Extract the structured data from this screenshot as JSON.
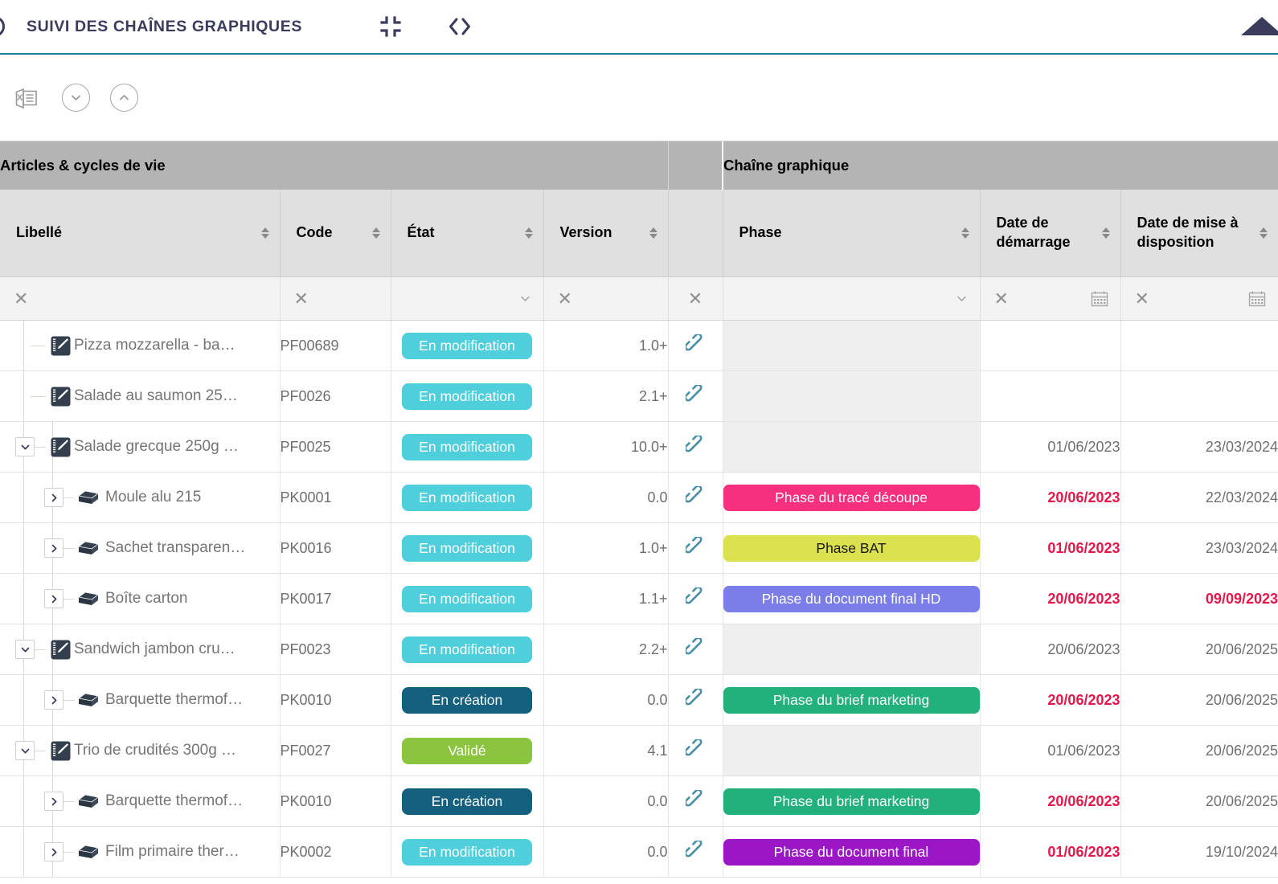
{
  "header": {
    "title": "SUIVI DES CHAÎNES GRAPHIQUES",
    "logo_icon": "circle-logo-icon",
    "collapse_icon": "collapse-fullscreen-icon",
    "code_icon": "code-brackets-icon",
    "panel_toggle_icon": "triangle-up-icon"
  },
  "toolbar": {
    "export_excel": {
      "icon": "excel-export-icon",
      "label": ""
    },
    "expand_all": {
      "icon": "chevron-down-circle-icon",
      "label": ""
    },
    "collapse_all": {
      "icon": "chevron-up-circle-icon",
      "label": ""
    }
  },
  "groups": [
    {
      "label": "Articles & cycles de vie"
    },
    {
      "label": "Chaîne graphique"
    }
  ],
  "columns": [
    {
      "key": "libelle",
      "label": "Libellé",
      "sortable": true,
      "filter": "clear"
    },
    {
      "key": "code",
      "label": "Code",
      "sortable": true,
      "filter": "clear"
    },
    {
      "key": "etat",
      "label": "État",
      "sortable": true,
      "filter": "dropdown"
    },
    {
      "key": "version",
      "label": "Version",
      "sortable": true,
      "filter": "clear"
    },
    {
      "key": "lien",
      "label": "",
      "sortable": false,
      "filter": "clear"
    },
    {
      "key": "phase",
      "label": "Phase",
      "sortable": true,
      "filter": "dropdown"
    },
    {
      "key": "date_demarrage",
      "label": "Date de démarrage",
      "sortable": true,
      "filter": "clear-calendar"
    },
    {
      "key": "date_mise_a_disposition",
      "label": "Date de mise à disposition",
      "sortable": true,
      "filter": "clear-calendar"
    }
  ],
  "colors": {
    "accent_underline": "#1b7f94",
    "brand_dark": "#3b3b5c",
    "group_band": "#b4b4b4",
    "column_header": "#e0e0e0",
    "filter_row": "#f3f3f3",
    "empty_cell": "#efefef",
    "date_overdue": "#e8174a",
    "link_icon": "#4a90a8",
    "status_en_modification": "#4fced c",
    "status_en_creation": "#14607e",
    "status_valide": "#8bc53f"
  },
  "status_colors": {
    "En modification": "#4fcedc",
    "En création": "#14607e",
    "Validé": "#8bc53f"
  },
  "phase_colors": {
    "Phase du tracé découpe": "#f72f7f",
    "Phase BAT": "#dbe14f",
    "Phase du document final HD": "#7b7ee8",
    "Phase du brief marketing": "#22b07d",
    "Phase du document final": "#9b17c6"
  },
  "phase_text_colors": {
    "Phase du tracé découpe": "#ffffff",
    "Phase BAT": "#1a1a1a",
    "Phase du document final HD": "#ffffff",
    "Phase du brief marketing": "#ffffff",
    "Phase du document final": "#ffffff"
  },
  "rows": [
    {
      "level": 0,
      "toggle": "none",
      "icon": "article-notebook-icon",
      "libelle": "Pizza mozzarella - ba…",
      "code": "PF00689",
      "etat": "En modification",
      "version": "1.0+",
      "link_icon": "link-chain-icon",
      "phase": "",
      "date_demarrage": "",
      "date_demarrage_red": false,
      "date_mise_a_disposition": "",
      "date_mise_red": false
    },
    {
      "level": 0,
      "toggle": "none",
      "icon": "article-notebook-icon",
      "libelle": "Salade au saumon 25…",
      "code": "PF0026",
      "etat": "En modification",
      "version": "2.1+",
      "link_icon": "link-chain-icon",
      "phase": "",
      "date_demarrage": "",
      "date_demarrage_red": false,
      "date_mise_a_disposition": "",
      "date_mise_red": false
    },
    {
      "level": 0,
      "toggle": "expanded",
      "icon": "article-notebook-icon",
      "libelle": "Salade grecque 250g …",
      "code": "PF0025",
      "etat": "En modification",
      "version": "10.0+",
      "link_icon": "link-chain-icon",
      "phase": "",
      "date_demarrage": "01/06/2023",
      "date_demarrage_red": false,
      "date_mise_a_disposition": "23/03/2024",
      "date_mise_red": false
    },
    {
      "level": 1,
      "toggle": "collapsed",
      "icon": "package-box-icon",
      "libelle": "Moule alu 215",
      "code": "PK0001",
      "etat": "En modification",
      "version": "0.0",
      "link_icon": "link-chain-icon",
      "phase": "Phase du tracé découpe",
      "date_demarrage": "20/06/2023",
      "date_demarrage_red": true,
      "date_mise_a_disposition": "22/03/2024",
      "date_mise_red": false
    },
    {
      "level": 1,
      "toggle": "collapsed",
      "icon": "package-box-icon",
      "libelle": "Sachet transparen…",
      "code": "PK0016",
      "etat": "En modification",
      "version": "1.0+",
      "link_icon": "link-chain-icon",
      "phase": "Phase BAT",
      "date_demarrage": "01/06/2023",
      "date_demarrage_red": true,
      "date_mise_a_disposition": "23/03/2024",
      "date_mise_red": false
    },
    {
      "level": 1,
      "toggle": "collapsed",
      "icon": "package-box-icon",
      "libelle": "Boîte carton",
      "code": "PK0017",
      "etat": "En modification",
      "version": "1.1+",
      "link_icon": "link-chain-icon",
      "phase": "Phase du document final HD",
      "date_demarrage": "20/06/2023",
      "date_demarrage_red": true,
      "date_mise_a_disposition": "09/09/2023",
      "date_mise_red": true
    },
    {
      "level": 0,
      "toggle": "expanded",
      "icon": "article-notebook-icon",
      "libelle": "Sandwich jambon cru…",
      "code": "PF0023",
      "etat": "En modification",
      "version": "2.2+",
      "link_icon": "link-chain-icon",
      "phase": "",
      "date_demarrage": "20/06/2023",
      "date_demarrage_red": false,
      "date_mise_a_disposition": "20/06/2025",
      "date_mise_red": false
    },
    {
      "level": 1,
      "toggle": "collapsed",
      "icon": "package-box-icon",
      "libelle": "Barquette thermof…",
      "code": "PK0010",
      "etat": "En création",
      "version": "0.0",
      "link_icon": "link-chain-icon",
      "phase": "Phase du brief marketing",
      "date_demarrage": "20/06/2023",
      "date_demarrage_red": true,
      "date_mise_a_disposition": "20/06/2025",
      "date_mise_red": false
    },
    {
      "level": 0,
      "toggle": "expanded",
      "icon": "article-notebook-icon",
      "libelle": "Trio de crudités 300g …",
      "code": "PF0027",
      "etat": "Validé",
      "version": "4.1",
      "link_icon": "link-chain-icon",
      "phase": "",
      "date_demarrage": "01/06/2023",
      "date_demarrage_red": false,
      "date_mise_a_disposition": "20/06/2025",
      "date_mise_red": false
    },
    {
      "level": 1,
      "toggle": "collapsed",
      "icon": "package-box-icon",
      "libelle": "Barquette thermof…",
      "code": "PK0010",
      "etat": "En création",
      "version": "0.0",
      "link_icon": "link-chain-icon",
      "phase": "Phase du brief marketing",
      "date_demarrage": "20/06/2023",
      "date_demarrage_red": true,
      "date_mise_a_disposition": "20/06/2025",
      "date_mise_red": false
    },
    {
      "level": 1,
      "toggle": "collapsed",
      "icon": "package-box-icon",
      "libelle": "Film primaire ther…",
      "code": "PK0002",
      "etat": "En modification",
      "version": "0.0",
      "link_icon": "link-chain-icon",
      "phase": "Phase du document final",
      "date_demarrage": "01/06/2023",
      "date_demarrage_red": true,
      "date_mise_a_disposition": "19/10/2024",
      "date_mise_red": false
    }
  ]
}
